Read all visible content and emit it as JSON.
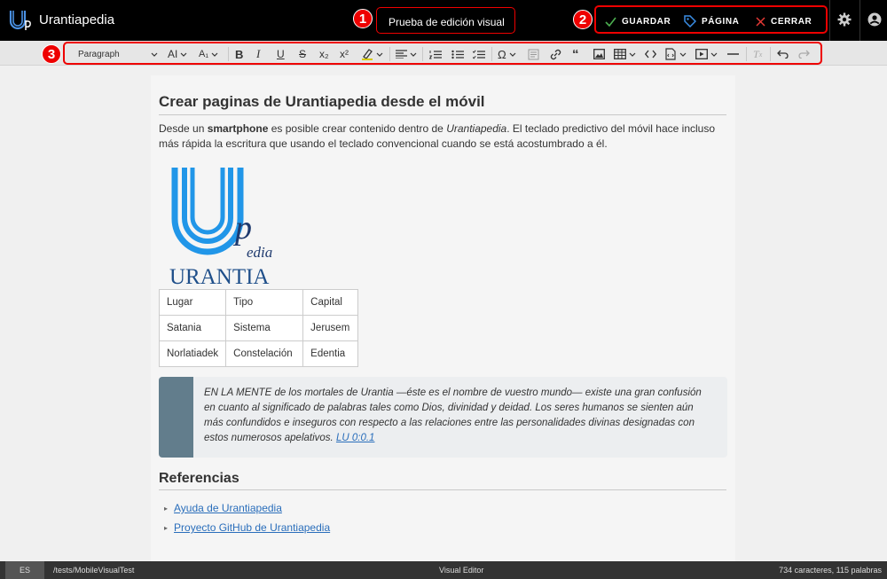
{
  "header": {
    "app_name": "Urantiapedia",
    "page_title": "Prueba de edición visual",
    "actions": {
      "save": "GUARDAR",
      "page": "PÁGINA",
      "close": "CERRAR"
    },
    "badges": [
      "1",
      "2",
      "3"
    ],
    "colors": {
      "save_check": "#4caf50",
      "page_tag": "#3a8ee6",
      "close_x": "#e53935",
      "highlight": "#e00000"
    }
  },
  "toolbar": {
    "paragraph_format": "Paragraph",
    "icons": [
      "heading-size-icon",
      "font-size-icon",
      "bold-icon",
      "italic-icon",
      "underline-icon",
      "strikethrough-icon",
      "subscript-icon",
      "superscript-icon",
      "highlight-icon",
      "align-icon",
      "numbered-list-icon",
      "bulleted-list-icon",
      "todo-list-icon",
      "special-characters-icon",
      "format-painter-icon",
      "link-icon",
      "blockquote-icon",
      "image-icon",
      "table-icon",
      "code-icon",
      "code-block-icon",
      "media-icon",
      "horizontal-line-icon",
      "remove-format-icon",
      "undo-icon",
      "redo-icon"
    ]
  },
  "document": {
    "title": "Crear paginas de Urantiapedia desde el móvil",
    "intro": {
      "t1": "Desde un ",
      "strong": "smartphone",
      "t2": " es posible crear contenido dentro de ",
      "em": "Urantiapedia",
      "t3": ". El teclado predictivo del móvil hace incluso más rápida la escritura que usando el teclado convencional cuando se está acostumbrado a él."
    },
    "logo": {
      "big_letter": "U",
      "small_letter": "p",
      "small_word": "edia",
      "name": "URANTIA"
    },
    "table": {
      "rows": [
        [
          "Lugar",
          "Tipo",
          "Capital"
        ],
        [
          "Satania",
          "Sistema",
          "Jerusem"
        ],
        [
          "Norlatiadek",
          "Constelación",
          "Edentia"
        ]
      ]
    },
    "quote": {
      "text": "EN LA MENTE de los mortales de Urantia —éste es el nombre de vuestro mundo— existe una gran confusión en cuanto al significado de palabras tales como Dios, divinidad y deidad. Los seres humanos se sienten aún más confundidos e inseguros con respecto a las relaciones entre las personalidades divinas designadas con estos numerosos apelativos.",
      "link": "LU 0:0.1"
    },
    "references": {
      "title": "Referencias",
      "items": [
        "Ayuda de Urantiapedia",
        "Proyecto GitHub de Urantiapedia"
      ]
    }
  },
  "statusbar": {
    "language": "ES",
    "path": "/tests/MobileVisualTest",
    "mode": "Visual Editor",
    "counts": "734 caracteres, 115 palabras"
  }
}
